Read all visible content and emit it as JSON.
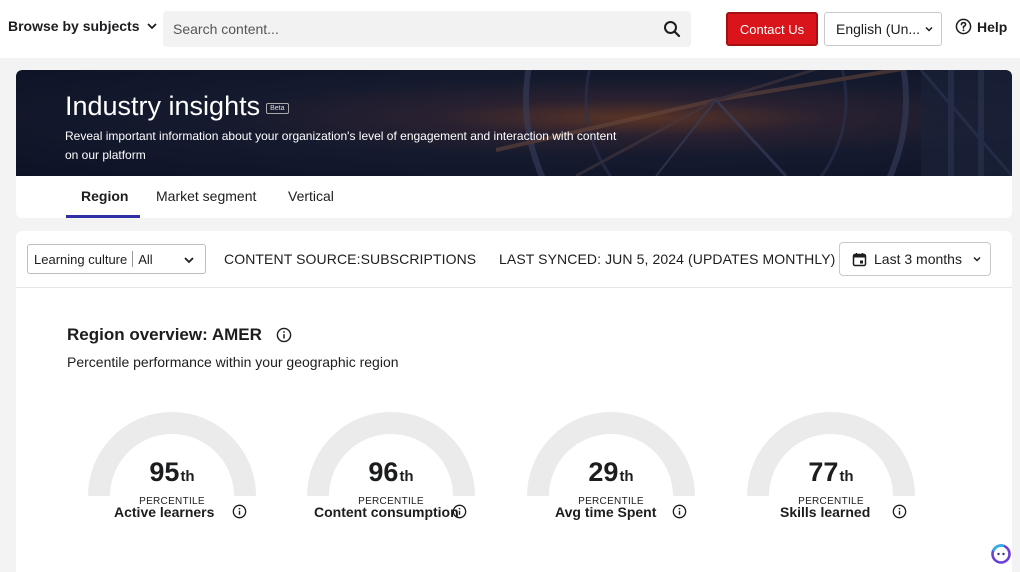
{
  "nav": {
    "browse_label": "Browse by subjects",
    "search_placeholder": "Search content...",
    "contact_label": "Contact Us",
    "language_label": "English (Un...",
    "help_label": "Help"
  },
  "hero": {
    "title": "Industry insights",
    "badge": "Beta",
    "description": "Reveal important information about your organization's level of engagement and interaction with content on our platform"
  },
  "tabs": [
    {
      "label": "Region",
      "active": true
    },
    {
      "label": "Market segment",
      "active": false
    },
    {
      "label": "Vertical",
      "active": false
    }
  ],
  "filters": {
    "select_label": "Learning culture",
    "select_value": "All",
    "content_source": "CONTENT SOURCE:SUBSCRIPTIONS",
    "last_synced": "LAST SYNCED: JUN 5, 2024 (UPDATES MONTHLY)",
    "date_range": "Last 3 months"
  },
  "overview": {
    "title": "Region overview: AMER",
    "subtitle": "Percentile performance within your geographic region"
  },
  "gauges": [
    {
      "value": "95",
      "suffix": "th",
      "unit": "PERCENTILE",
      "label": "Active learners"
    },
    {
      "value": "96",
      "suffix": "th",
      "unit": "PERCENTILE",
      "label": "Content consumption"
    },
    {
      "value": "29",
      "suffix": "th",
      "unit": "PERCENTILE",
      "label": "Avg time Spent"
    },
    {
      "value": "77",
      "suffix": "th",
      "unit": "PERCENTILE",
      "label": "Skills learned"
    }
  ],
  "colors": {
    "accent": "#2d2fa3",
    "contact": "#d9151b",
    "gauge_track": "#ebebeb"
  }
}
